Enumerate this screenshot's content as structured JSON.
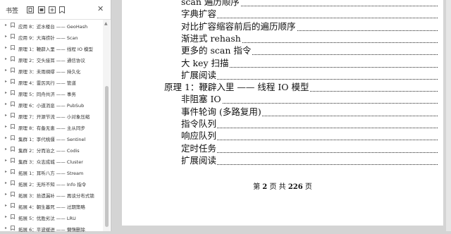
{
  "sidebar": {
    "title": "书签",
    "close_icon": "✕",
    "items": [
      {
        "label": "应用 8：近水楼台 —— GeoHash"
      },
      {
        "label": "应用 9：大海捞针 —— Scan"
      },
      {
        "label": "原理 1：鞭辟入里 —— 线程 IO 模型"
      },
      {
        "label": "原理 2：交头接耳 —— 通信协议"
      },
      {
        "label": "原理 3：未雨绸缪 —— 持久化"
      },
      {
        "label": "原理 4：雷厉风行 —— 管道"
      },
      {
        "label": "原理 5：同舟共济 —— 事务"
      },
      {
        "label": "原理 6：小道消息 —— PubSub"
      },
      {
        "label": "原理 7：开源节流 —— 小对象压缩"
      },
      {
        "label": "原理 8：有备无患 —— 主从同步"
      },
      {
        "label": "集群 1：李代桃僵 —— Sentinel"
      },
      {
        "label": "集群 2：分而治之 —— Codis"
      },
      {
        "label": "集群 3：众志成城 —— Cluster"
      },
      {
        "label": "拓展 1：耳听八方 —— Stream"
      },
      {
        "label": "拓展 2：无所不知 —— Info 指令"
      },
      {
        "label": "拓展 3：拾遗漏补 —— 再谈分布式锁"
      },
      {
        "label": "拓展 4：朝生暮死 —— 过期策略"
      },
      {
        "label": "拓展 5：优胜劣汰 —— LRU"
      },
      {
        "label": "拓展 6：平波缓进 —— 懒惰删除"
      }
    ]
  },
  "document": {
    "toc_lines": [
      {
        "text": "scan 遍历顺序",
        "level": 2
      },
      {
        "text": "字典扩容",
        "level": 2
      },
      {
        "text": "对比扩容缩容前后的遍历顺序",
        "level": 2
      },
      {
        "text": "渐进式 rehash",
        "level": 2
      },
      {
        "text": "更多的 scan 指令",
        "level": 2
      },
      {
        "text": "大 key 扫描",
        "level": 2
      },
      {
        "text": "扩展阅读",
        "level": 2
      },
      {
        "text": "原理 1：鞭辟入里 —— 线程 IO 模型",
        "level": 1
      },
      {
        "text": "非阻塞 IO",
        "level": 2
      },
      {
        "text": "事件轮询 (多路复用)",
        "level": 2
      },
      {
        "text": "指令队列",
        "level": 2
      },
      {
        "text": "响应队列",
        "level": 2
      },
      {
        "text": "定时任务",
        "level": 2
      },
      {
        "text": "扩展阅读",
        "level": 2
      }
    ],
    "footer": {
      "prefix": "第",
      "page": "2",
      "mid": "页 共",
      "total": "226",
      "suffix": "页"
    }
  }
}
